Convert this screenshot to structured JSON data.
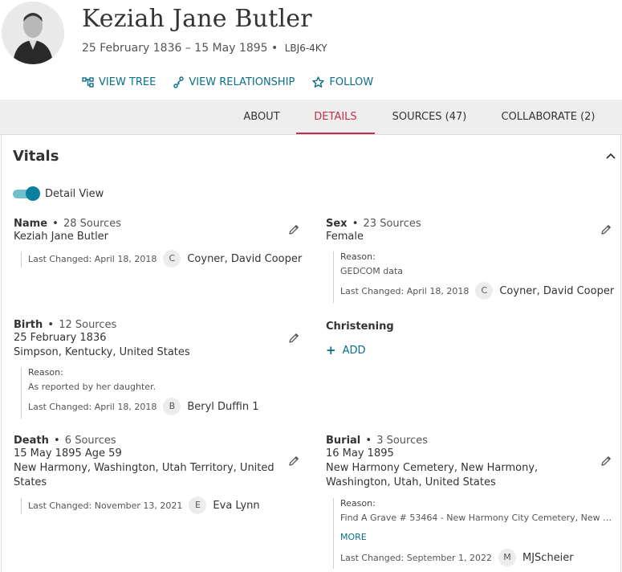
{
  "person": {
    "name": "Keziah Jane Butler",
    "lifespan": "25 February 1836 – 15 May 1895",
    "pid": "LBJ6-4KY"
  },
  "actions": [
    {
      "label": "VIEW TREE",
      "icon": "tree-icon"
    },
    {
      "label": "VIEW RELATIONSHIP",
      "icon": "relationship-icon"
    },
    {
      "label": "FOLLOW",
      "icon": "star-icon"
    }
  ],
  "tabs": [
    {
      "label": "ABOUT",
      "active": false
    },
    {
      "label": "DETAILS",
      "active": true
    },
    {
      "label": "SOURCES (47)",
      "active": false
    },
    {
      "label": "COLLABORATE (2)",
      "active": false
    }
  ],
  "vitals": {
    "title": "Vitals",
    "detail_view_label": "Detail View",
    "detail_view_on": true,
    "name": {
      "label": "Name",
      "sources": "28 Sources",
      "lines": [
        "Keziah Jane Butler"
      ],
      "last_changed": "Last Changed: April 18, 2018",
      "contributor_initial": "C",
      "contributor": "Coyner, David Cooper"
    },
    "sex": {
      "label": "Sex",
      "sources": "23 Sources",
      "lines": [
        "Female"
      ],
      "reason_label": "Reason:",
      "reason": "GEDCOM data",
      "last_changed": "Last Changed: April 18, 2018",
      "contributor_initial": "C",
      "contributor": "Coyner, David Cooper"
    },
    "birth": {
      "label": "Birth",
      "sources": "12 Sources",
      "lines": [
        "25 February 1836",
        "Simpson, Kentucky, United States"
      ],
      "reason_label": "Reason:",
      "reason": "As reported by her daughter.",
      "last_changed": "Last Changed: April 18, 2018",
      "contributor_initial": "B",
      "contributor": "Beryl Duffin 1"
    },
    "christening": {
      "label": "Christening",
      "add_label": "ADD"
    },
    "death": {
      "label": "Death",
      "sources": "6 Sources",
      "lines": [
        "15 May 1895 Age 59",
        "New Harmony, Washington, Utah Territory, United",
        "States"
      ],
      "last_changed": "Last Changed: November 13, 2021",
      "contributor_initial": "E",
      "contributor": "Eva Lynn"
    },
    "burial": {
      "label": "Burial",
      "sources": "3 Sources",
      "lines": [
        "16 May 1895",
        "New Harmony Cemetery, New Harmony,",
        "Washington, Utah, United States"
      ],
      "reason_label": "Reason:",
      "reason": "Find A Grave # 53464 - New Harmony City Cemetery, New …",
      "more_label": "MORE",
      "last_changed": "Last Changed: September 1, 2022",
      "contributor_initial": "M",
      "contributor": "MJScheier"
    }
  },
  "colors": {
    "accent_teal": "#0a6f88",
    "active_tab": "#c03050",
    "toggle_on": "#0a7f9e"
  }
}
